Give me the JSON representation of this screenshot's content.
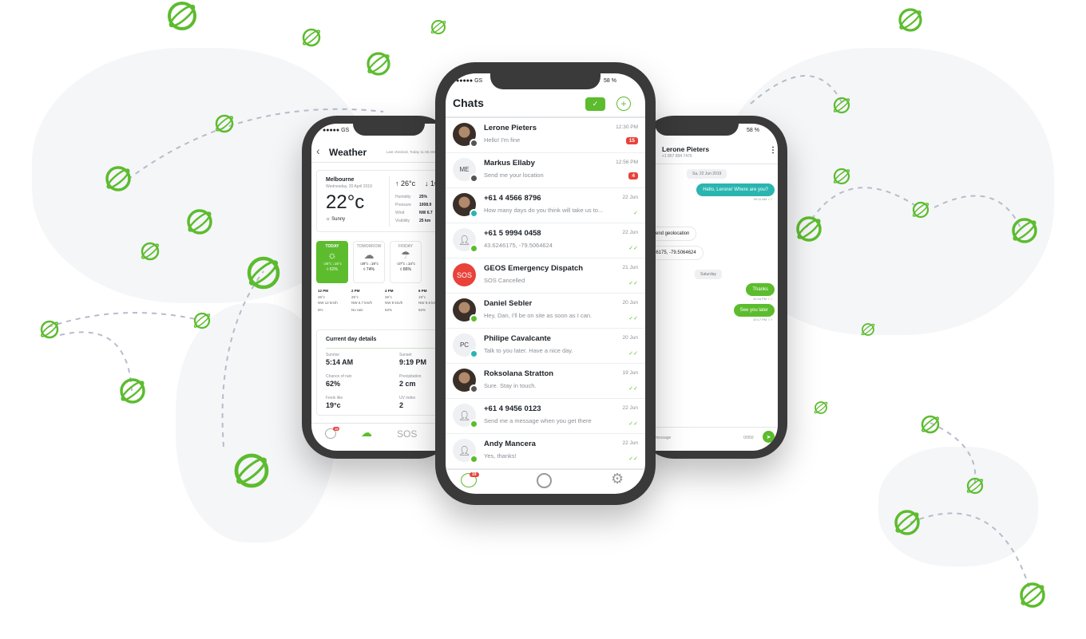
{
  "colors": {
    "brand_green": "#5cbc2e",
    "alert_red": "#e8423a",
    "teal": "#2ab5b0"
  },
  "chats": {
    "status": {
      "carrier": "●●●●● GS",
      "battery": "58 %"
    },
    "title": "Chats",
    "select_icon": "check-icon",
    "new_icon": "new-chat-icon",
    "items": [
      {
        "name": "Lerone Pieters",
        "message": "Hello! I'm fine",
        "time": "12:30 PM",
        "unread": "15",
        "avatar": "photo",
        "status": "gray"
      },
      {
        "name": "Markus Ellaby",
        "message": "Send me your location",
        "time": "12:56 PM",
        "unread": "4",
        "avatar": "ME",
        "status": "gray"
      },
      {
        "name": "+61 4 4566 8796",
        "message": "How many days do you think will take us to...",
        "time": "22 Jun",
        "read": "✓",
        "avatar": "photo",
        "status": "teal"
      },
      {
        "name": "+61 5 9994 0458",
        "message": "43.6246175, -79.5064624",
        "time": "22 Jun",
        "read": "✓✓",
        "avatar": "person",
        "status": "green"
      },
      {
        "name": "GEOS Emergency Dispatch",
        "message": "SOS Cancelled",
        "time": "21 Jun",
        "read": "✓✓",
        "avatar": "SOS",
        "status": ""
      },
      {
        "name": "Daniel Sebler",
        "message": "Hey, Dan, I'll be on site as soon as I can.",
        "time": "20 Jun",
        "read": "✓✓",
        "avatar": "photo",
        "status": "green"
      },
      {
        "name": "Philipe Cavalcante",
        "message": "Talk to you later. Have a nice day.",
        "time": "20 Jun",
        "read": "✓✓",
        "avatar": "PC",
        "status": "teal"
      },
      {
        "name": "Roksolana Stratton",
        "message": "Sure. Stay in touch.",
        "time": "19 Jun",
        "read": "✓✓",
        "avatar": "photo",
        "status": "gray"
      },
      {
        "name": "+61 4 9456 0123",
        "message": "Send me a message when you get there",
        "time": "22 Jun",
        "read": "✓✓",
        "avatar": "person",
        "status": "green"
      },
      {
        "name": "Andy Mancera",
        "message": "Yes, thanks!",
        "time": "22 Jun",
        "read": "✓✓",
        "avatar": "person",
        "status": "green"
      }
    ],
    "nav": {
      "chats_badge": "19",
      "chats_icon": "chat-bubble-icon",
      "geos_icon": "geos-logo-icon",
      "settings_icon": "gear-icon"
    }
  },
  "weather": {
    "status": {
      "carrier": "●●●●● GS"
    },
    "title": "Weather",
    "last_checked": "Last checked, Today 11:35 AM",
    "city": "Melbourne",
    "date": "Wednesday, 20 April 2019",
    "temp": "22°c",
    "condition": "Sunny",
    "high": "↑ 26°c",
    "low": "↓ 16°c",
    "stats": [
      {
        "label": "Humidity",
        "value": "25%"
      },
      {
        "label": "Pressure",
        "value": "1008.9"
      },
      {
        "label": "Wind",
        "value": "NW 6.7"
      },
      {
        "label": "Visibility",
        "value": "25 km"
      }
    ],
    "days": [
      {
        "label": "TODAY",
        "icon": "sun",
        "temps": "↑26°c ↓16°c",
        "rain": "62%"
      },
      {
        "label": "TOMORROW",
        "icon": "cloud",
        "temps": "↑29°c ↓19°c",
        "rain": "74%"
      },
      {
        "label": "FRIDAY",
        "icon": "rain-cloud",
        "temps": "↑27°c ↓14°c",
        "rain": "86%"
      }
    ],
    "hourly": [
      {
        "time": "12 PM",
        "temp": "26°c",
        "wind": "NW 12 km/h",
        "rain": "5%"
      },
      {
        "time": "2 PM",
        "temp": "25°c",
        "wind": "NW 6.7 km/h",
        "rain": "No rain"
      },
      {
        "time": "4 PM",
        "temp": "26°c",
        "wind": "NW 8 km/h",
        "rain": "62%"
      },
      {
        "time": "6 PM",
        "temp": "19°c",
        "wind": "NW 9.6 km/h",
        "rain": "62%"
      }
    ],
    "details_title": "Current day details",
    "details": [
      {
        "label": "Sunrise",
        "value": "5:14 AM"
      },
      {
        "label": "Sunset",
        "value": "9:19 PM"
      },
      {
        "label": "Chance of rain",
        "value": "62%"
      },
      {
        "label": "Precipitation",
        "value": "2 cm"
      },
      {
        "label": "Feels like",
        "value": "19°c"
      },
      {
        "label": "UV index",
        "value": "2"
      }
    ],
    "nav": {
      "badge": "19",
      "sos": "SOS"
    }
  },
  "conversation": {
    "status": {
      "battery": "58 %"
    },
    "contact": "Lerone Pieters",
    "phone": "+1 867 894 7476",
    "date_chip": "Sa, 22 Jun 2019",
    "messages": [
      {
        "text": "Hello, Lerone! Where are you?",
        "dir": "out",
        "time": "09:11 AM"
      },
      {
        "text": "send geolocation",
        "dir": "in"
      },
      {
        "text": "46175, -79.5064624",
        "dir": "in"
      },
      {
        "text": "Thanks",
        "dir": "out",
        "time": "10:16 PM"
      },
      {
        "text": "See you later",
        "dir": "out",
        "time": "10:17 PM"
      }
    ],
    "day_chip": "Saturday",
    "input_placeholder": "message",
    "counter": "0/950"
  }
}
